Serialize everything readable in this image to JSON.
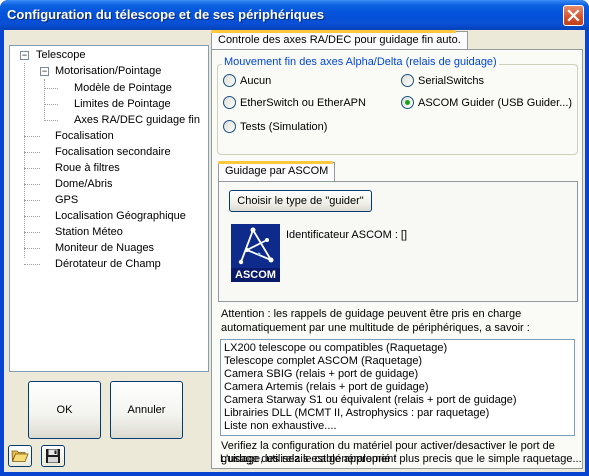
{
  "window": {
    "title": "Configuration du télescope et de ses périphériques",
    "close_icon": "close-icon"
  },
  "tree": {
    "items": [
      {
        "label": "Telescope",
        "expander": "⊟"
      },
      {
        "label": "Motorisation/Pointage",
        "expander": "⊟"
      },
      {
        "label": "Modèle de Pointage"
      },
      {
        "label": "Limites de Pointage"
      },
      {
        "label": "Axes RA/DEC guidage fin"
      },
      {
        "label": "Focalisation"
      },
      {
        "label": "Focalisation secondaire"
      },
      {
        "label": "Roue à filtres"
      },
      {
        "label": "Dome/Abris"
      },
      {
        "label": "GPS"
      },
      {
        "label": "Localisation Géographique"
      },
      {
        "label": "Station Méteo"
      },
      {
        "label": "Moniteur de Nuages"
      },
      {
        "label": "Dérotateur de Champ"
      }
    ]
  },
  "buttons": {
    "ok_label": "OK",
    "cancel_label": "Annuler",
    "open_icon": "folder-open-icon",
    "save_icon": "floppy-save-icon"
  },
  "main": {
    "tab_label": "Controle des axes RA/DEC pour guidage fin auto.",
    "group_legend": "Mouvement fin des axes Alpha/Delta  (relais de guidage)",
    "radios": [
      {
        "label": "Aucun",
        "selected": false
      },
      {
        "label": "SerialSwitchs",
        "selected": false
      },
      {
        "label": "EtherSwitch ou EtherAPN",
        "selected": false
      },
      {
        "label": "ASCOM Guider (USB Guider...)",
        "selected": true
      },
      {
        "label": "Tests (Simulation)",
        "selected": false
      }
    ],
    "sub_tab_label": "Guidage par ASCOM",
    "choose_button_label": "Choisir le type de \"guider\"",
    "ascom_logo_text": "ASCOM",
    "identifier_text": "Identificateur ASCOM : []",
    "attention_line1": "Attention : les rappels de guidage peuvent être pris en charge",
    "attention_line2": "automatiquement par une multitude de périphériques, a savoir :",
    "list": [
      "LX200 telescope ou compatibles (Raquetage)",
      "Telescope complet ASCOM (Raquetage)",
      "Camera SBIG (relais + port de guidage)",
      "Camera Artemis (relais + port de guidage)",
      "Camera Starway S1 ou équivalent (relais + port de guidage)",
      "Librairies DLL (MCMT II, Astrophysics : par raquetage)",
      "Liste non exhaustive...."
    ],
    "verify_line1": "Verifiez la configuration du matériel pour activer/desactiver le port de",
    "verify_line2": "guidage, utilisez le cable approprié !",
    "usage_line": "L'usage des relais est généralement plus precis que le simple raquetage..."
  },
  "colors": {
    "titlebar": "#0351da",
    "window_bg": "#ece9d8",
    "legend_text": "#0046d5",
    "radio_selected": "#21a121",
    "ascom_logo_bg": "#0a1a6a"
  }
}
